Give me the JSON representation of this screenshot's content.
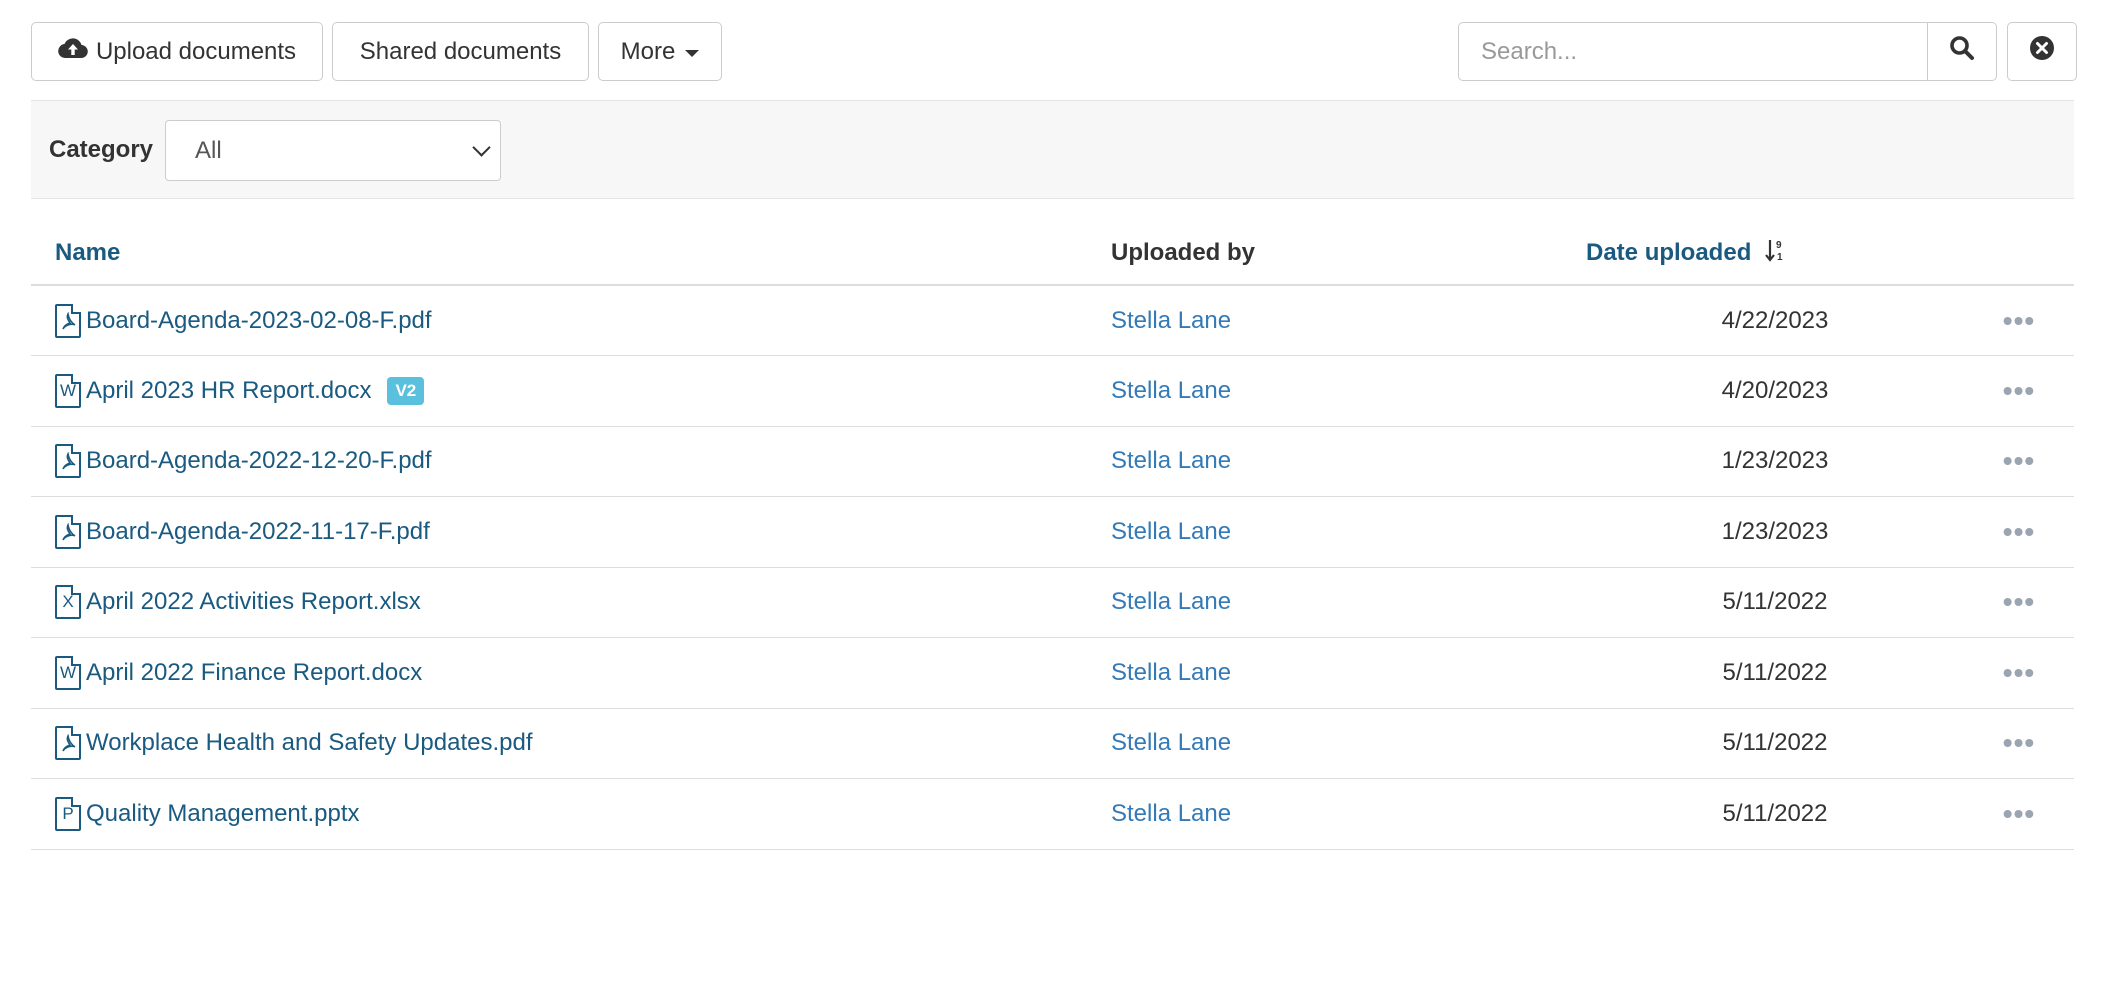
{
  "toolbar": {
    "upload_label": "Upload documents",
    "shared_label": "Shared documents",
    "more_label": "More",
    "search_placeholder": "Search..."
  },
  "filter": {
    "category_label": "Category",
    "category_selected": "All"
  },
  "table": {
    "columns": {
      "name": "Name",
      "uploaded_by": "Uploaded by",
      "date_uploaded": "Date uploaded"
    },
    "rows": [
      {
        "icon": "pdf-file-icon",
        "name": "Board-Agenda-2023-02-08-F.pdf",
        "badge": "",
        "uploaded_by": "Stella Lane",
        "date": "4/22/2023"
      },
      {
        "icon": "word-file-icon",
        "name": "April 2023 HR Report.docx",
        "badge": "V2",
        "uploaded_by": "Stella Lane",
        "date": "4/20/2023"
      },
      {
        "icon": "pdf-file-icon",
        "name": "Board-Agenda-2022-12-20-F.pdf",
        "badge": "",
        "uploaded_by": "Stella Lane",
        "date": "1/23/2023"
      },
      {
        "icon": "pdf-file-icon",
        "name": "Board-Agenda-2022-11-17-F.pdf",
        "badge": "",
        "uploaded_by": "Stella Lane",
        "date": "1/23/2023"
      },
      {
        "icon": "excel-file-icon",
        "name": "April 2022 Activities Report.xlsx",
        "badge": "",
        "uploaded_by": "Stella Lane",
        "date": "5/11/2022"
      },
      {
        "icon": "word-file-icon",
        "name": "April 2022 Finance Report.docx",
        "badge": "",
        "uploaded_by": "Stella Lane",
        "date": "5/11/2022"
      },
      {
        "icon": "pdf-file-icon",
        "name": "Workplace Health and Safety Updates.pdf",
        "badge": "",
        "uploaded_by": "Stella Lane",
        "date": "5/11/2022"
      },
      {
        "icon": "powerpoint-file-icon",
        "name": "Quality Management.pptx",
        "badge": "",
        "uploaded_by": "Stella Lane",
        "date": "5/11/2022"
      }
    ]
  },
  "colors": {
    "link_dark": "#1a5a80",
    "link": "#337ab7",
    "badge": "#5bc0de",
    "dots": "#9aa5b1"
  }
}
